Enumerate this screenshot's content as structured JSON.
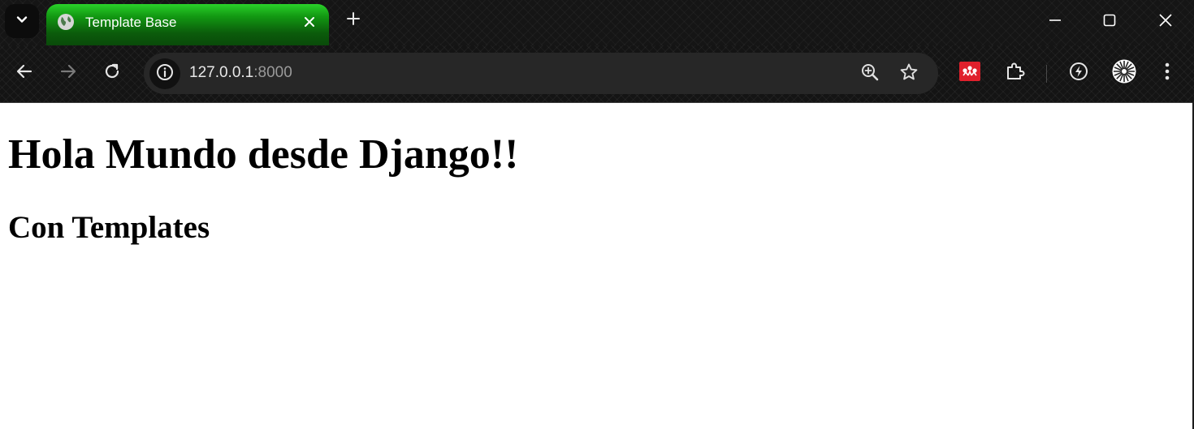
{
  "browser": {
    "tab": {
      "title": "Template Base",
      "favicon": "globe-icon"
    },
    "address_bar": {
      "host": "127.0.0.1",
      "port": ":8000"
    },
    "toolbar_icons": [
      "back-arrow-icon",
      "forward-arrow-icon",
      "reload-icon",
      "site-info-icon",
      "zoom-icon",
      "bookmark-star-icon",
      "mendeley-extension-icon",
      "extensions-puzzle-icon",
      "performance-icon",
      "profile-avatar-icon",
      "more-menu-icon"
    ],
    "window_controls": [
      "minimize-icon",
      "maximize-icon",
      "close-icon"
    ],
    "colors": {
      "active_tab": "#129812",
      "extension_red": "#e0202c",
      "frame": "#151515"
    }
  },
  "page": {
    "heading": "Hola Mundo desde Django!!",
    "subheading": "Con Templates"
  }
}
